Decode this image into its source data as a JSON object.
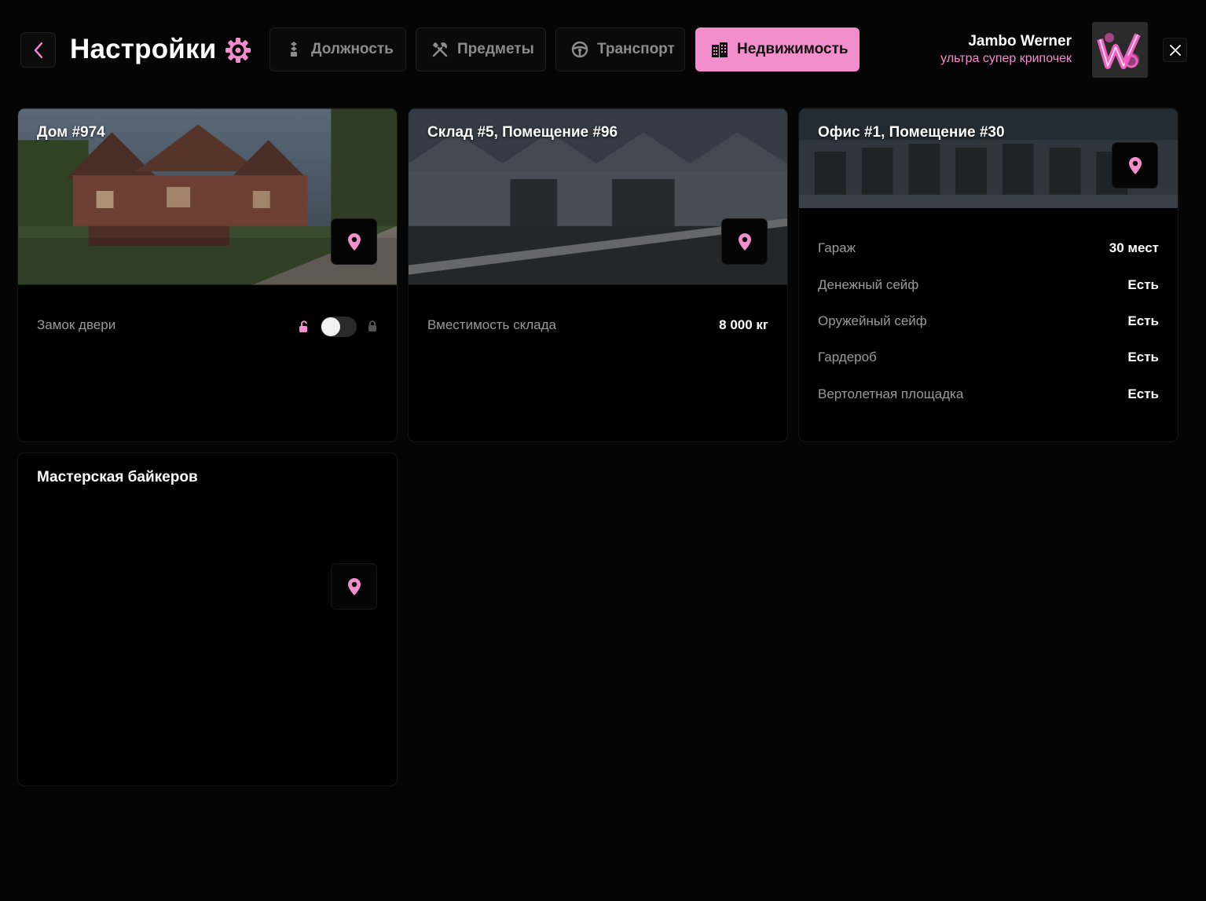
{
  "header": {
    "title": "Настройки",
    "tabs": [
      {
        "label": "Должность",
        "icon": "rank-icon"
      },
      {
        "label": "Предметы",
        "icon": "tools-icon"
      },
      {
        "label": "Транспорт",
        "icon": "steering-wheel-icon"
      },
      {
        "label": "Недвижимость",
        "icon": "building-icon",
        "active": true
      }
    ],
    "user": {
      "name": "Jambo Werner",
      "role": "ультра супер крипочек"
    }
  },
  "cards": [
    {
      "title": "Дом #974",
      "rows": [
        {
          "label": "Замок двери",
          "control": "toggle",
          "toggle_on": false
        }
      ]
    },
    {
      "title": "Склад #5, Помещение #96",
      "rows": [
        {
          "label": "Вместимость склада",
          "value": "8 000 кг"
        }
      ]
    },
    {
      "title": "Офис #1, Помещение #30",
      "rows": [
        {
          "label": "Гараж",
          "value": "30 мест"
        },
        {
          "label": "Денежный сейф",
          "value": "Есть"
        },
        {
          "label": "Оружейный сейф",
          "value": "Есть"
        },
        {
          "label": "Гардероб",
          "value": "Есть"
        },
        {
          "label": "Вертолетная площадка",
          "value": "Есть"
        }
      ]
    },
    {
      "title": "Мастерская байкеров",
      "rows": []
    }
  ],
  "colors": {
    "accent": "#f38ecd",
    "background": "#050505",
    "card": "#000000"
  }
}
